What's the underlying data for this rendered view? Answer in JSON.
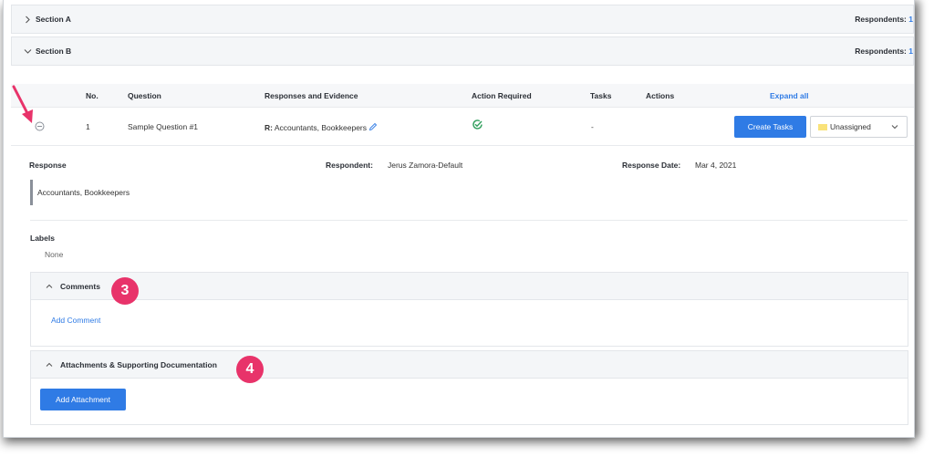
{
  "sections": [
    {
      "title": "Section A",
      "respondents_label": "Respondents:",
      "respondents_count": "1",
      "expanded": false
    },
    {
      "title": "Section B",
      "respondents_label": "Respondents:",
      "respondents_count": "1",
      "expanded": true
    }
  ],
  "table": {
    "headers": {
      "no": "No.",
      "question": "Question",
      "responses": "Responses and Evidence",
      "action_required": "Action Required",
      "tasks": "Tasks",
      "actions": "Actions",
      "expand_all": "Expand all"
    },
    "rows": [
      {
        "no": "1",
        "question": "Sample Question #1",
        "response_prefix": "R:",
        "response": "Accountants, Bookkeepers",
        "tasks": "-",
        "create_tasks_label": "Create Tasks",
        "assignee": "Unassigned"
      }
    ]
  },
  "detail": {
    "response_label": "Response",
    "respondent_label": "Respondent:",
    "respondent_value": "Jerus Zamora-Default",
    "response_date_label": "Response Date:",
    "response_date_value": "Mar 4, 2021",
    "response_text": "Accountants, Bookkeepers",
    "labels_label": "Labels",
    "labels_value": "None"
  },
  "comments": {
    "title": "Comments",
    "add_label": "Add Comment",
    "badge": "3"
  },
  "attachments": {
    "title": "Attachments & Supporting Documentation",
    "add_label": "Add Attachment",
    "badge": "4"
  },
  "colors": {
    "accent": "#2f7be5",
    "badge": "#e8336a",
    "check": "#2e9e5b",
    "swatch": "#f9e27a"
  }
}
